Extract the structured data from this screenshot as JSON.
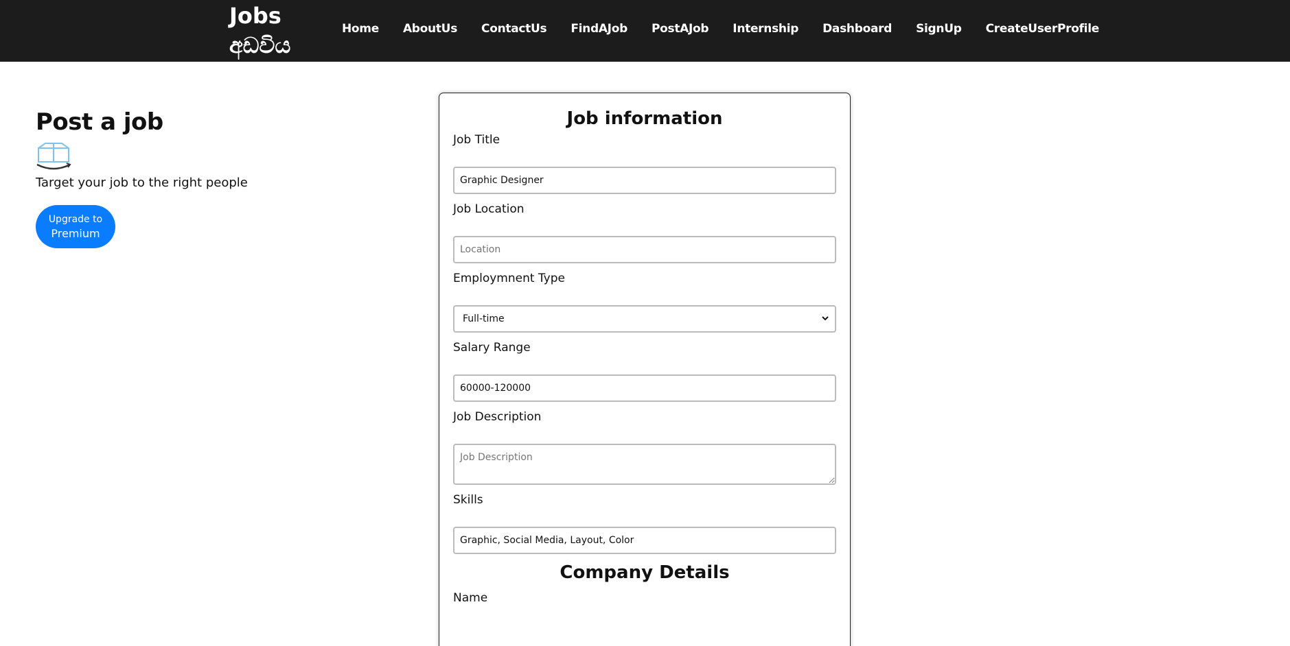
{
  "brand": {
    "line1": "Jobs",
    "line2": "අඩවිය"
  },
  "nav": [
    {
      "label": "Home"
    },
    {
      "label": "AboutUs"
    },
    {
      "label": "ContactUs"
    },
    {
      "label": "FindAJob"
    },
    {
      "label": "PostAJob"
    },
    {
      "label": "Internship"
    },
    {
      "label": "Dashboard"
    },
    {
      "label": "SignUp"
    },
    {
      "label": "CreateUserProfile"
    }
  ],
  "sidebar": {
    "title": "Post a job",
    "tagline": "Target your job to the right people",
    "button_line1": "Upgrade to",
    "button_line2": "Premium",
    "icon": "package-box-icon"
  },
  "form": {
    "section_title": "Job information",
    "job_title": {
      "label": "Job Title",
      "value": "Graphic Designer"
    },
    "job_location": {
      "label": "Job Location",
      "value": "",
      "placeholder": "Location"
    },
    "employment_type": {
      "label": "Employmnent Type",
      "selected": "Full-time"
    },
    "salary_range": {
      "label": "Salary Range",
      "value": "60000-120000"
    },
    "job_description": {
      "label": "Job Description",
      "value": "",
      "placeholder": "Job Description"
    },
    "skills": {
      "label": "Skills",
      "value": "Graphic, Social Media, Layout, Color"
    },
    "company_section_title": "Company Details",
    "company_name": {
      "label": "Name"
    }
  },
  "colors": {
    "navbar_bg": "#1c1c1c",
    "accent": "#0a7cff"
  }
}
